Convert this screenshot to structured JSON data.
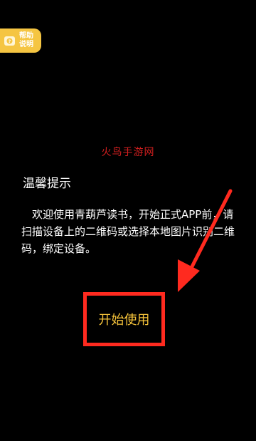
{
  "help": {
    "label": "帮助说明",
    "icon": "question-icon"
  },
  "watermark": "火鸟手游网",
  "tip": {
    "title": "温馨提示",
    "body": "欢迎使用青葫芦读书，开始正式APP前，请扫描设备上的二维码或选择本地图片识别二维码，绑定设备。"
  },
  "start_button": {
    "label": "开始使用"
  },
  "colors": {
    "background": "#000000",
    "help_badge": "#f5c542",
    "button_text": "#f4c23a",
    "annotation_red": "#ff2a1f",
    "watermark": "#d21f1f"
  }
}
